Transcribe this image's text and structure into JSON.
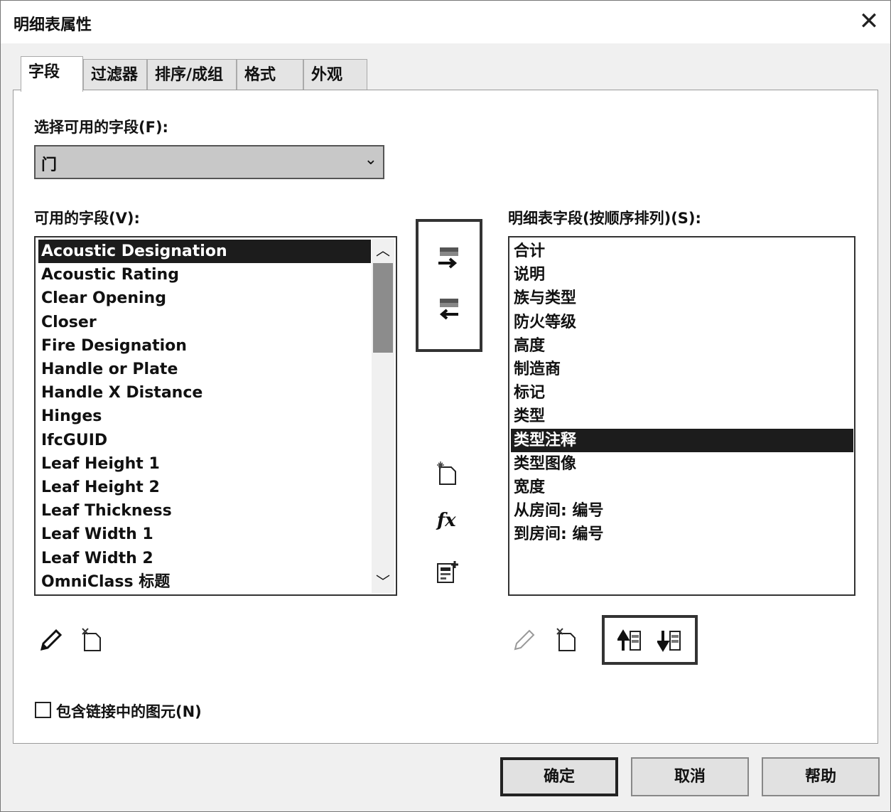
{
  "window": {
    "title": "明细表属性",
    "close_glyph": "✕"
  },
  "tabs": [
    "字段",
    "过滤器",
    "排序/成组",
    "格式",
    "外观"
  ],
  "fields_tab": {
    "select_label": "选择可用的字段(F):",
    "category_value": "门",
    "available_label": "可用的字段(V):",
    "available_fields": [
      "Acoustic Designation",
      "Acoustic Rating",
      "Clear Opening",
      "Closer",
      "Fire Designation",
      "Handle or Plate",
      "Handle X Distance",
      "Hinges",
      "IfcGUID",
      "Leaf Height 1",
      "Leaf Height 2",
      "Leaf Thickness",
      "Leaf Width 1",
      "Leaf Width 2",
      "OmniClass 标题"
    ],
    "available_selected_index": 0,
    "schedule_label": "明细表字段(按顺序排列)(S):",
    "schedule_fields": [
      "合计",
      "说明",
      "族与类型",
      "防火等级",
      "高度",
      "制造商",
      "标记",
      "类型",
      "类型注释",
      "类型图像",
      "宽度",
      "从房间: 编号",
      "到房间: 编号"
    ],
    "schedule_selected_index": 8,
    "include_linked_label": "包含链接中的图元(N)",
    "include_linked_checked": false
  },
  "buttons": {
    "ok": "确定",
    "cancel": "取消",
    "help": "帮助"
  },
  "icons": {
    "add": "add-field-icon",
    "remove": "remove-field-icon",
    "new_param": "new-parameter-icon",
    "calc": "calculated-value-icon",
    "combine": "combine-parameters-icon",
    "edit": "edit-parameter-icon",
    "delete": "delete-parameter-icon",
    "move_up": "move-up-icon",
    "move_down": "move-down-icon",
    "fx_text": "fx"
  }
}
